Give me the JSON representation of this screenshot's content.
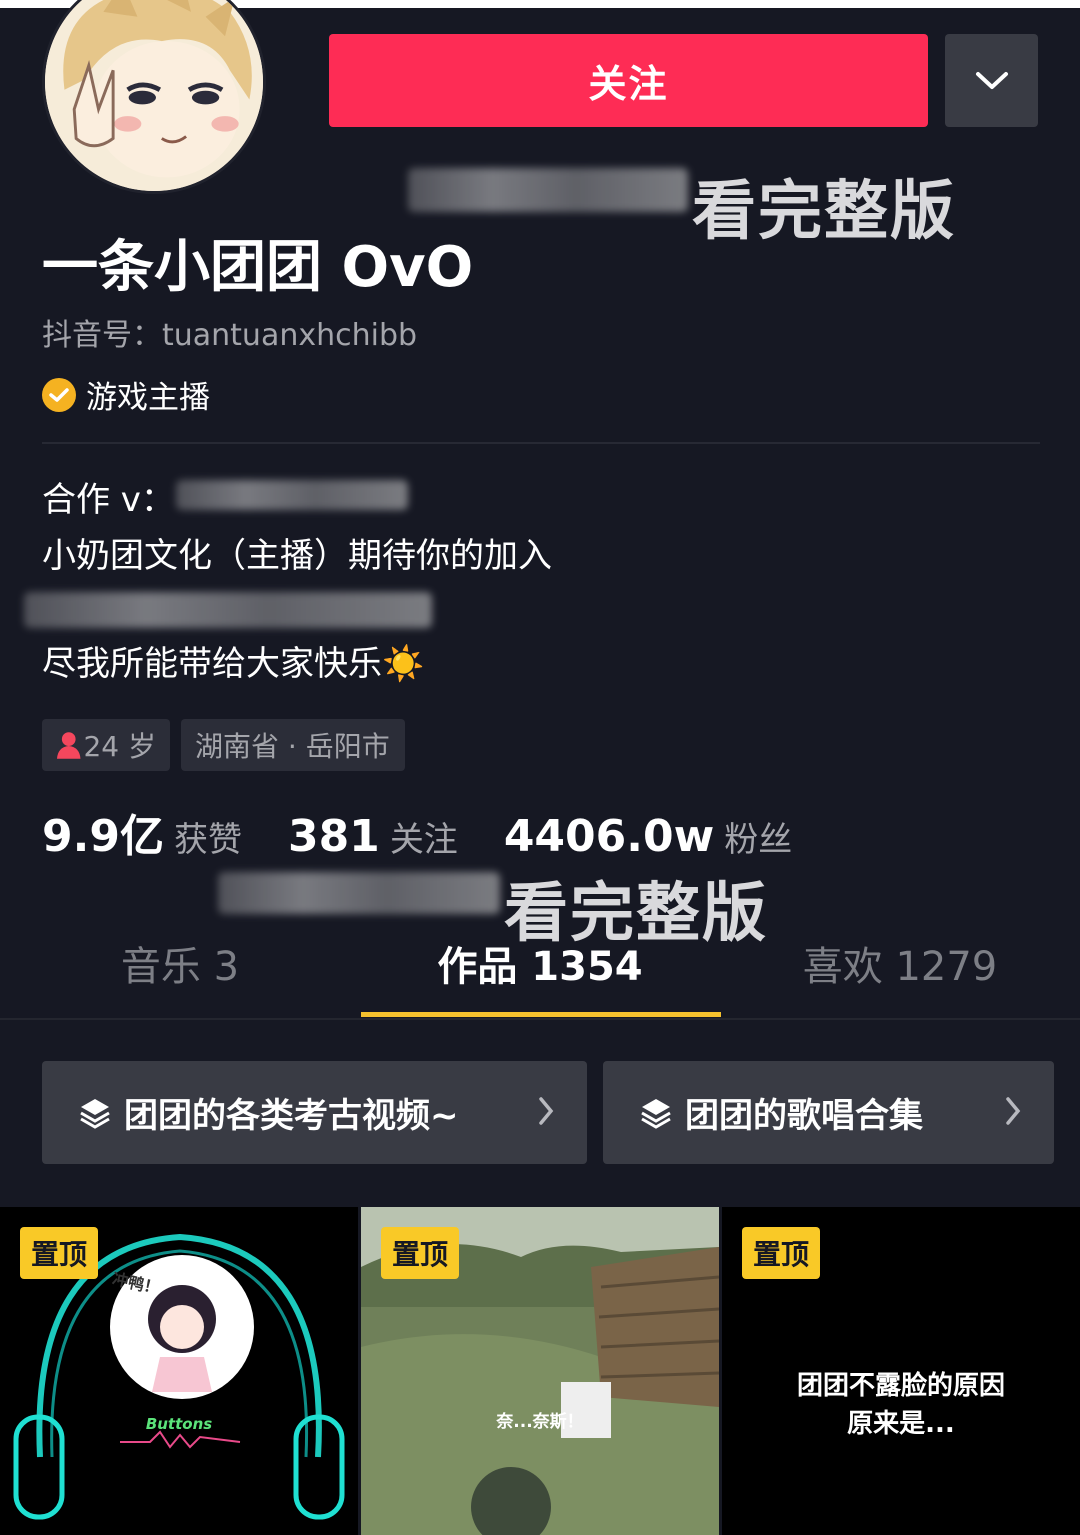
{
  "profile": {
    "name": "一条小团团 OvO",
    "douyin_id": "抖音号：tuantuanxhchibb",
    "verified_label": "游戏主播",
    "follow_label": "关注",
    "watermark": "看完整版"
  },
  "bio": {
    "line1": "合作 v：",
    "line2": "小奶团文化（主播）期待你的加入",
    "line4": "尽我所能带给大家快乐",
    "emoji": "☀️"
  },
  "tags": {
    "age": "24 岁",
    "location": "湖南省 · 岳阳市"
  },
  "stats": {
    "likes_num": "9.9亿",
    "likes_label": "获赞",
    "following_num": "381",
    "following_label": "关注",
    "followers_num": "4406.0w",
    "followers_label": "粉丝"
  },
  "tabs": [
    {
      "label": "音乐 3"
    },
    {
      "label": "作品 1354"
    },
    {
      "label": "喜欢 1279"
    }
  ],
  "collections": [
    {
      "label": "团团的各类考古视频~"
    },
    {
      "label": "团团的歌唱合集"
    }
  ],
  "videos": [
    {
      "pin": "置顶",
      "sticker": "冲鸭！",
      "text": "Buttons"
    },
    {
      "pin": "置顶",
      "sticker": "奈...奈斯！"
    },
    {
      "pin": "置顶",
      "caption1": "团团不露脸的原因",
      "caption2": "原来是..."
    }
  ],
  "colors": {
    "background": "#161823",
    "follow": "#fe2c55",
    "accent": "#f5c12e",
    "verified": "#f5b221"
  }
}
